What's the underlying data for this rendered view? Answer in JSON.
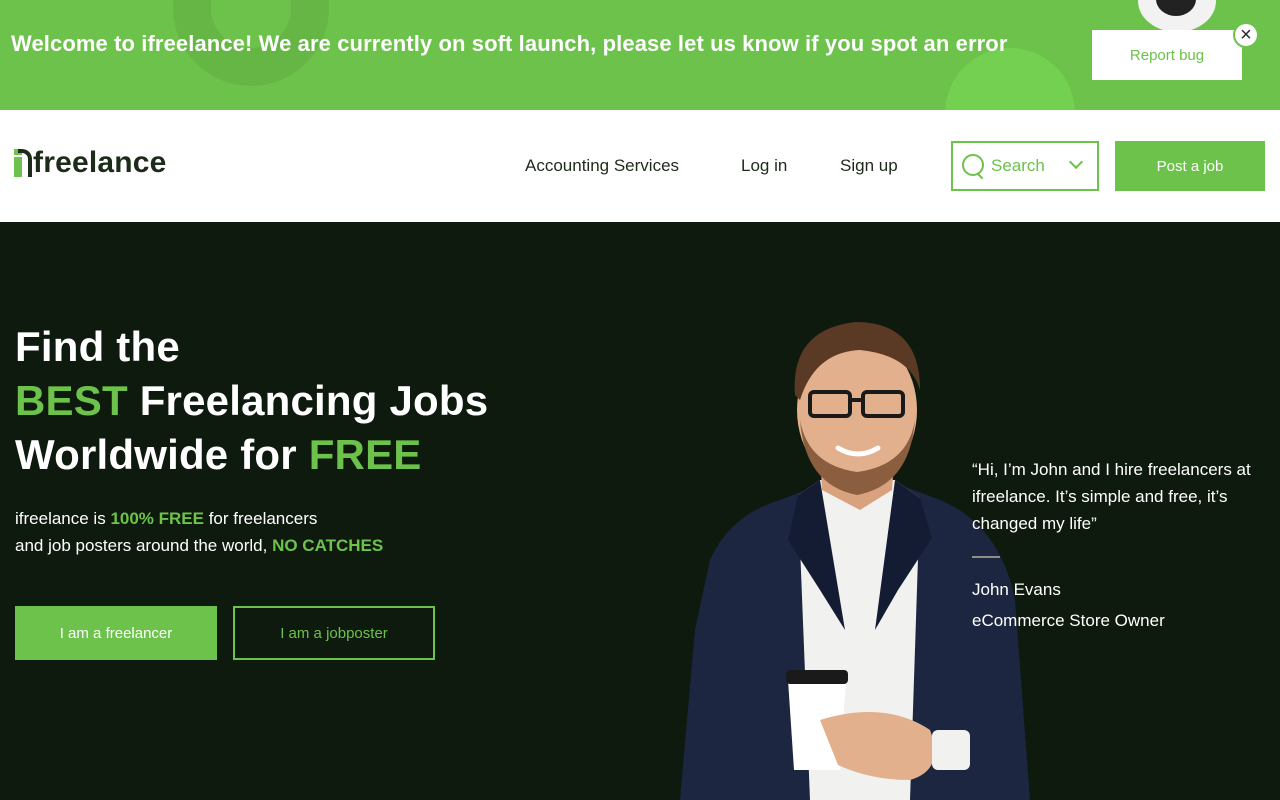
{
  "banner": {
    "message": "Welcome to ifreelance! We are currently on soft launch, please let us know if you spot an error",
    "report_label": "Report bug",
    "close_glyph": "×"
  },
  "header": {
    "logo_text": "freelance",
    "nav": {
      "accounting": "Accounting Services",
      "login": "Log in",
      "signup": "Sign up"
    },
    "search_label": "Search",
    "post_label": "Post a job"
  },
  "hero": {
    "line1": "Find the",
    "line2_accent": "BEST",
    "line2_rest": " Freelancing Jobs",
    "line3_rest": "Worldwide for ",
    "line3_accent": "FREE",
    "sub1_pre": "ifreelance is ",
    "sub1_accent": "100% FREE",
    "sub1_post": " for freelancers",
    "sub2_pre": "and job posters around the world, ",
    "sub2_accent": "NO CATCHES",
    "btn_freelancer": "I am a freelancer",
    "btn_jobposter": "I am a jobposter"
  },
  "testimonial": {
    "quote": "“Hi, I’m John and I hire freelancers at ifreelance. It’s simple and free, it’s changed my life”",
    "name": "John Evans",
    "role": "eCommerce Store Owner"
  },
  "colors": {
    "brand_green": "#6cc24a",
    "hero_bg": "#0f1a0f",
    "dark_text": "#1d2b1a"
  },
  "icons": [
    "close-icon",
    "search-icon",
    "chevron-down-icon",
    "logo-mark-icon"
  ]
}
